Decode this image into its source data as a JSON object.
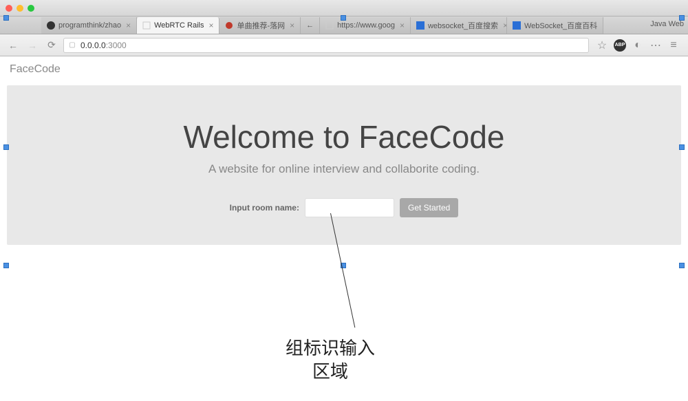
{
  "tabs": [
    {
      "label": "programthink/zhao",
      "icon": "github"
    },
    {
      "label": "WebRTC Rails",
      "icon": "blank",
      "active": true
    },
    {
      "label": "单曲推荐-落网",
      "icon": "luoo"
    },
    {
      "label": "https://www.goog",
      "icon": "blank"
    },
    {
      "label": "websocket_百度搜索",
      "icon": "baidu"
    },
    {
      "label": "WebSocket_百度百科",
      "icon": "baidu"
    }
  ],
  "tab_right_label": "Java Web",
  "url": {
    "host": "0.0.0.0",
    "port": ":3000"
  },
  "toolbar": {
    "abp_label": "ABP"
  },
  "page": {
    "brand": "FaceCode",
    "hero_title": "Welcome to FaceCode",
    "hero_subtitle": "A website for online interview and collaborite coding.",
    "input_label": "Input room name:",
    "button_label": "Get Started"
  },
  "annotation": "组标识输入\n区域"
}
